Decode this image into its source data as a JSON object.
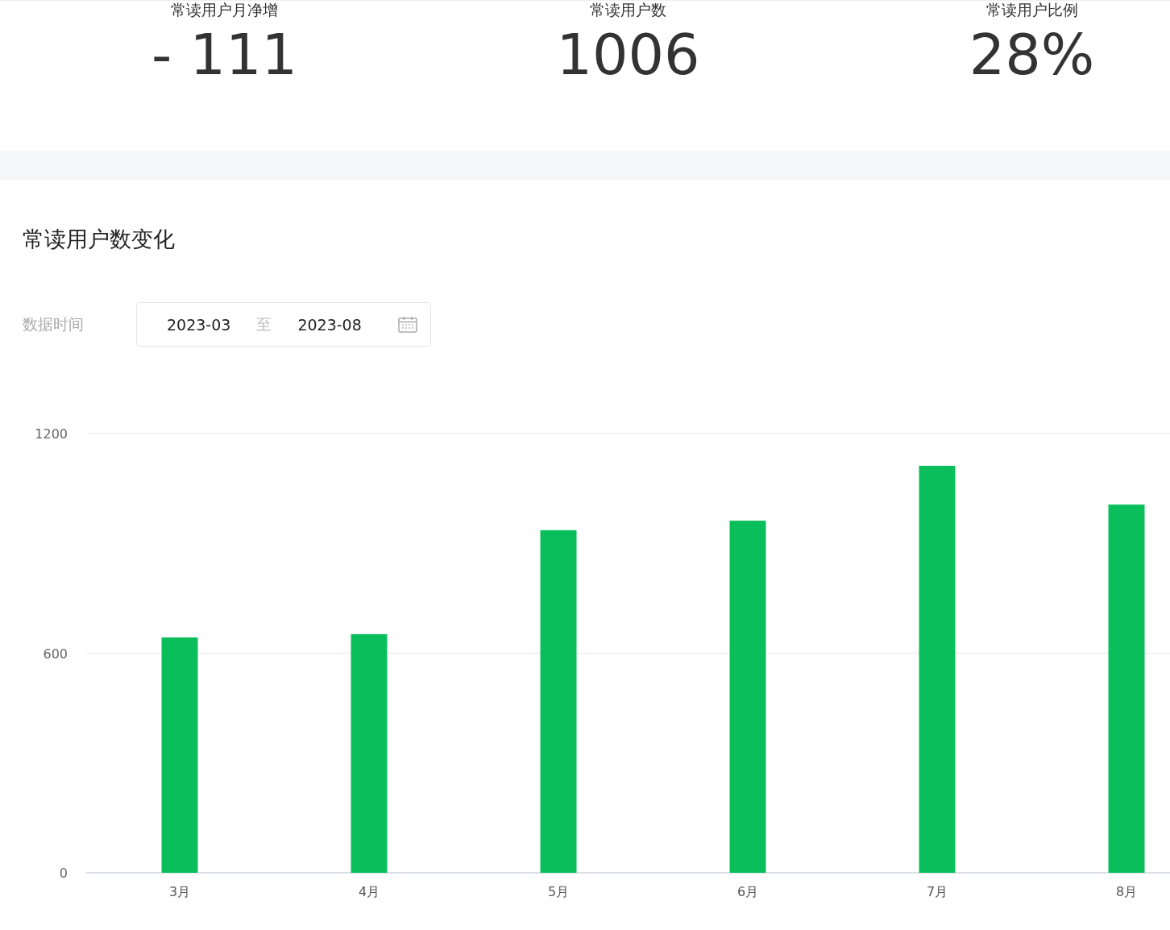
{
  "stats": [
    {
      "label": "常读用户月净增",
      "value": "- 111"
    },
    {
      "label": "常读用户数",
      "value": "1006"
    },
    {
      "label": "常读用户比例",
      "value": "28%"
    }
  ],
  "trend": {
    "title": "常读用户数变化",
    "date_filter": {
      "label": "数据时间",
      "start": "2023-03",
      "separator": "至",
      "end": "2023-08"
    },
    "chart_data": {
      "type": "bar",
      "categories": [
        "3月",
        "4月",
        "5月",
        "6月",
        "7月",
        "8月"
      ],
      "series": [
        {
          "color": "#0abf5b",
          "values": [
            643,
            652,
            936,
            962,
            1112,
            1006
          ]
        }
      ],
      "ylim": [
        0,
        1200
      ],
      "yticks": [
        0,
        600,
        1200
      ]
    }
  }
}
